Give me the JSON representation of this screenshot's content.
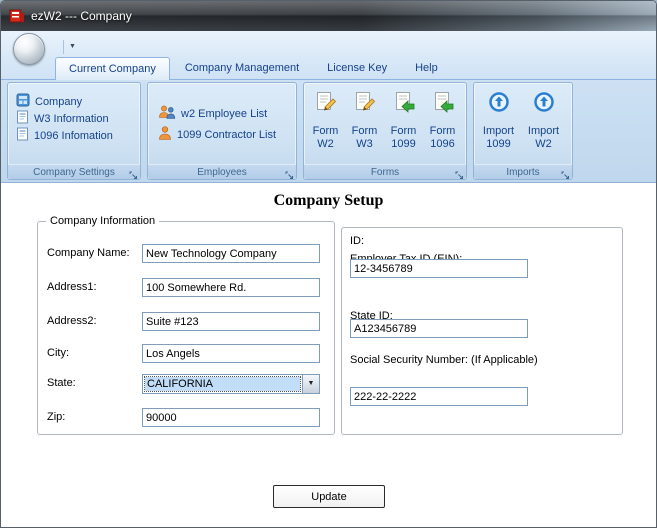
{
  "window": {
    "title": "ezW2 --- Company"
  },
  "colors": {
    "ribbon_text": "#15428b",
    "ribbon_bg": "#cde1f3",
    "titlebar_bg": "#2c3136",
    "combo_selection_bg": "#c1ddf7"
  },
  "qat": {
    "dropdown_glyph": "▼"
  },
  "tabs": [
    {
      "label": "Current Company",
      "active": true
    },
    {
      "label": "Company Management",
      "active": false
    },
    {
      "label": "License Key",
      "active": false
    },
    {
      "label": "Help",
      "active": false
    }
  ],
  "company_settings_group": {
    "caption": "Company Settings",
    "items": [
      {
        "label": "Company"
      },
      {
        "label": "W3 Information"
      },
      {
        "label": "1096 Infomation"
      }
    ]
  },
  "employees_group": {
    "caption": "Employees",
    "items": [
      {
        "label": "w2 Employee List"
      },
      {
        "label": "1099 Contractor List"
      }
    ]
  },
  "forms_group": {
    "caption": "Forms",
    "items": [
      {
        "line1": "Form",
        "line2": "W2"
      },
      {
        "line1": "Form",
        "line2": "W3"
      },
      {
        "line1": "Form",
        "line2": "1099"
      },
      {
        "line1": "Form",
        "line2": "1096"
      }
    ]
  },
  "imports_group": {
    "caption": "Imports",
    "items": [
      {
        "line1": "Import",
        "line2": "1099"
      },
      {
        "line1": "Import",
        "line2": "W2"
      }
    ]
  },
  "main": {
    "heading": "Company Setup",
    "company_info": {
      "legend": "Company Information",
      "company_name": {
        "label": "Company Name:",
        "value": "New Technology Company"
      },
      "address1": {
        "label": "Address1:",
        "value": "100 Somewhere Rd."
      },
      "address2": {
        "label": "Address2:",
        "value": "Suite #123"
      },
      "city": {
        "label": "City:",
        "value": "Los Angels"
      },
      "state": {
        "label": "State:",
        "value": "CALIFORNIA"
      },
      "zip": {
        "label": "Zip:",
        "value": "90000"
      }
    },
    "id_section": {
      "title": "ID:",
      "ein": {
        "label": "Employer Tax ID (EIN):",
        "value": "12-3456789"
      },
      "state_id": {
        "label": "State ID:",
        "value": "A123456789"
      },
      "ssn": {
        "label": "Social Security Number: (If Applicable)",
        "value": "222-22-2222"
      }
    },
    "update_label": "Update"
  }
}
